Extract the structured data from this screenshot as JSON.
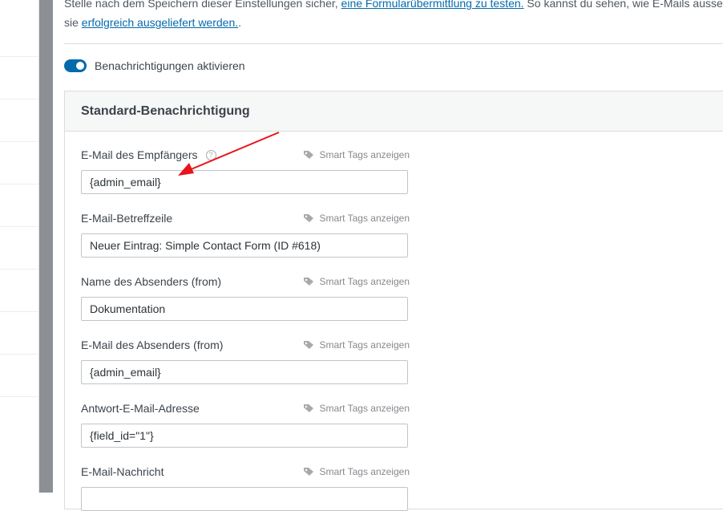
{
  "intro": {
    "line1_pre": "Stelle nach dem Speichern dieser Einstellungen sicher, ",
    "line1_link": "eine Formularübermittlung zu testen.",
    "line1_post": " So kannst du sehen, wie E-Mails ausse",
    "line2_pre": "sie ",
    "line2_link": "erfolgreich ausgeliefert werden.",
    "line2_post": "."
  },
  "toggle": {
    "label": "Benachrichtigungen aktivieren",
    "enabled": true
  },
  "panel": {
    "title": "Standard-Benachrichtigung"
  },
  "smart_tags_label": "Smart Tags anzeigen",
  "fields": [
    {
      "label": "E-Mail des Empfängers",
      "value": "{admin_email}",
      "has_help": true
    },
    {
      "label": "E-Mail-Betreffzeile",
      "value": "Neuer Eintrag: Simple Contact Form (ID #618)"
    },
    {
      "label": "Name des Absenders (from)",
      "value": "Dokumentation"
    },
    {
      "label": "E-Mail des Absenders (from)",
      "value": "{admin_email}"
    },
    {
      "label": "Antwort-E-Mail-Adresse",
      "value": "{field_id=\"1\"}"
    },
    {
      "label": "E-Mail-Nachricht",
      "value": ""
    }
  ],
  "colors": {
    "accent": "#056aab",
    "annotation_arrow": "#e8131b"
  },
  "icons": {
    "help": "question-circle-icon",
    "tag": "tag-icon",
    "toggle": "toggle-on"
  }
}
